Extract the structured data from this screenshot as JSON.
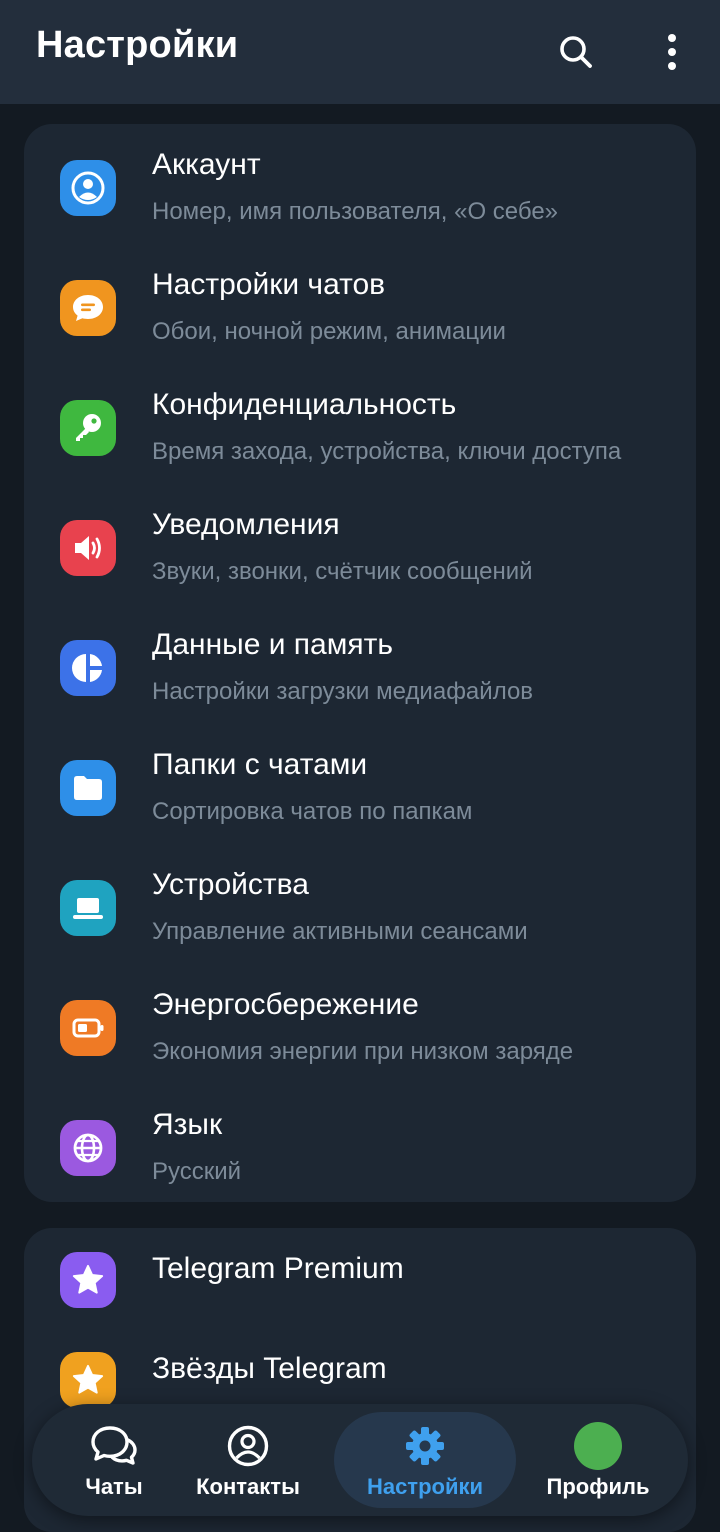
{
  "header": {
    "title": "Настройки",
    "search_icon": "search-icon",
    "menu_icon": "more-vertical-icon"
  },
  "settings": [
    {
      "title": "Аккаунт",
      "subtitle": "Номер, имя пользователя, «О себе»",
      "icon": "person-icon",
      "color": "#2e8fe8"
    },
    {
      "title": "Настройки чатов",
      "subtitle": "Обои, ночной режим, анимации",
      "icon": "chat-bubble-icon",
      "color": "#f0951f"
    },
    {
      "title": "Конфиденциальность",
      "subtitle": "Время захода, устройства, ключи доступа",
      "icon": "key-icon",
      "color": "#3fb83f"
    },
    {
      "title": "Уведомления",
      "subtitle": "Звуки, звонки, счётчик сообщений",
      "icon": "speaker-icon",
      "color": "#e8424e"
    },
    {
      "title": "Данные и память",
      "subtitle": "Настройки загрузки медиафайлов",
      "icon": "pie-chart-icon",
      "color": "#3c72e8"
    },
    {
      "title": "Папки с чатами",
      "subtitle": "Сортировка чатов по папкам",
      "icon": "folder-icon",
      "color": "#2e8fe8"
    },
    {
      "title": "Устройства",
      "subtitle": "Управление активными сеансами",
      "icon": "laptop-icon",
      "color": "#1fa3c0"
    },
    {
      "title": "Энергосбережение",
      "subtitle": "Экономия энергии при низком заряде",
      "icon": "battery-icon",
      "color": "#ef7a25"
    },
    {
      "title": "Язык",
      "subtitle": "Русский",
      "icon": "globe-icon",
      "color": "#9b59e0"
    }
  ],
  "premium": [
    {
      "title": "Telegram Premium",
      "icon": "star-icon",
      "color": "#8a5cf0"
    },
    {
      "title": "Звёзды Telegram",
      "icon": "star-icon",
      "color": "#f0a11f"
    }
  ],
  "nav": {
    "tabs": [
      {
        "label": "Чаты",
        "icon": "chats-icon"
      },
      {
        "label": "Контакты",
        "icon": "contacts-icon"
      },
      {
        "label": "Настройки",
        "icon": "gear-icon",
        "active": true
      },
      {
        "label": "Профиль",
        "icon": "avatar"
      }
    ],
    "active_color": "#3fa0ee",
    "avatar_color": "#4caf50"
  }
}
